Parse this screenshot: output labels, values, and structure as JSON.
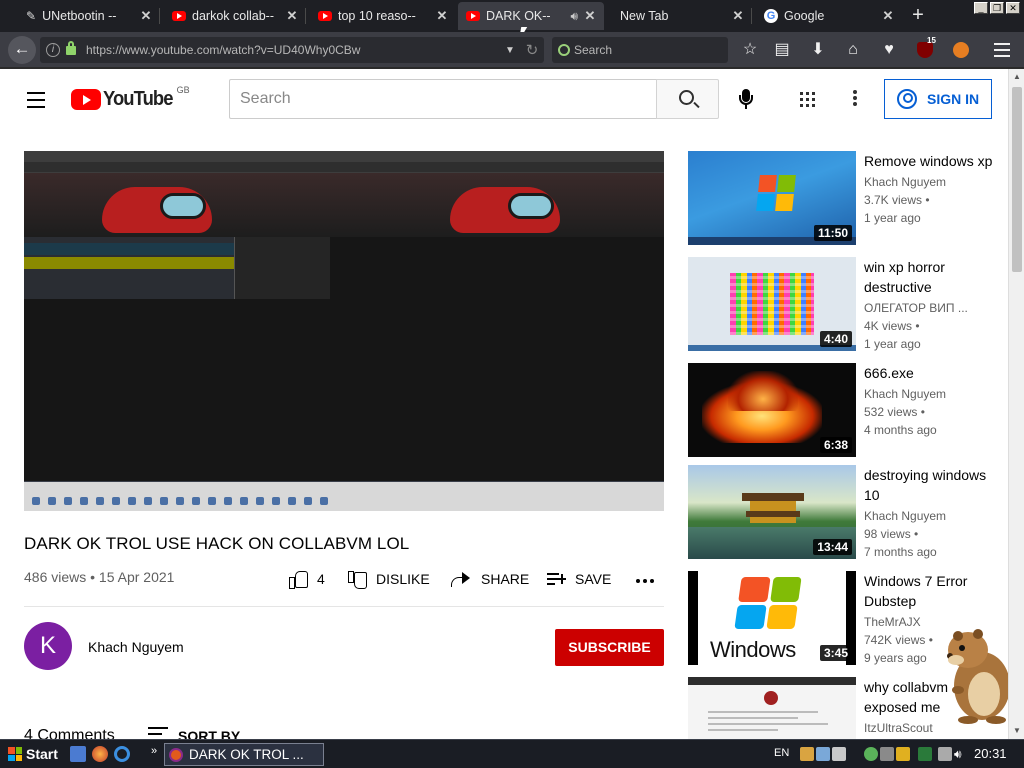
{
  "browser": {
    "tabs": [
      {
        "title": "UNetbootin -- ",
        "icon": "unetbootin-icon",
        "active": false
      },
      {
        "title": "darkok collab--",
        "icon": "youtube-icon",
        "active": false
      },
      {
        "title": "top 10 reaso--",
        "icon": "youtube-icon",
        "active": false
      },
      {
        "title": "DARK OK--",
        "icon": "youtube-icon",
        "active": true
      },
      {
        "title": "New Tab",
        "icon": "",
        "active": false
      },
      {
        "title": "Google",
        "icon": "google-icon",
        "active": false
      }
    ],
    "new_tab_symbol": "+",
    "url": "https://www.youtube.com/watch?v=UD40Why0CBw",
    "search_placeholder": "Search",
    "ublock_badge": "15"
  },
  "youtube": {
    "logo_text": "YouTube",
    "region": "GB",
    "search_placeholder": "Search",
    "sign_in_label": "SIGN IN",
    "video": {
      "title": "DARK OK TROL USE HACK ON COLLABVM LOL",
      "meta": "486 views • 15 Apr 2021",
      "like_count": "4",
      "dislike_label": "DISLIKE",
      "share_label": "SHARE",
      "save_label": "SAVE"
    },
    "channel": {
      "avatar_letter": "K",
      "avatar_color": "#7b1fa2",
      "name": "Khach Nguyem",
      "subscribe_label": "SUBSCRIBE"
    },
    "comments": {
      "count_label": "4 Comments",
      "sort_label": "SORT BY"
    },
    "recommendations": [
      {
        "title": "Remove windows xp",
        "channel": "Khach Nguyem",
        "views": "3.7K views •",
        "age": "1 year ago",
        "duration": "11:50"
      },
      {
        "title": "win xp horror destructive",
        "channel": "ОЛЕГАТОР ВИП ...",
        "views": "4K views •",
        "age": "1 year ago",
        "duration": "4:40"
      },
      {
        "title": "666.exe",
        "channel": "Khach Nguyem",
        "views": "532 views •",
        "age": "4 months ago",
        "duration": "6:38"
      },
      {
        "title": "destroying windows 10",
        "channel": "Khach Nguyem",
        "views": "98 views •",
        "age": "7 months ago",
        "duration": "13:44"
      },
      {
        "title": "Windows 7 Error Dubstep",
        "channel": "TheMrAJX",
        "views": "742K views •",
        "age": "9 years ago",
        "duration": "3:45",
        "thumb_text": "Windows"
      },
      {
        "title": "why collabvm exposed me",
        "channel": "ItzUltraScout",
        "views": "",
        "age": "",
        "duration": ""
      }
    ]
  },
  "taskbar": {
    "start_label": "Start",
    "task_title": "DARK OK TROL ...",
    "language": "EN",
    "clock": "20:31"
  },
  "colors": {
    "youtube_red": "#ff0000",
    "subscribe_red": "#cc0000",
    "signin_blue": "#065fd4"
  }
}
